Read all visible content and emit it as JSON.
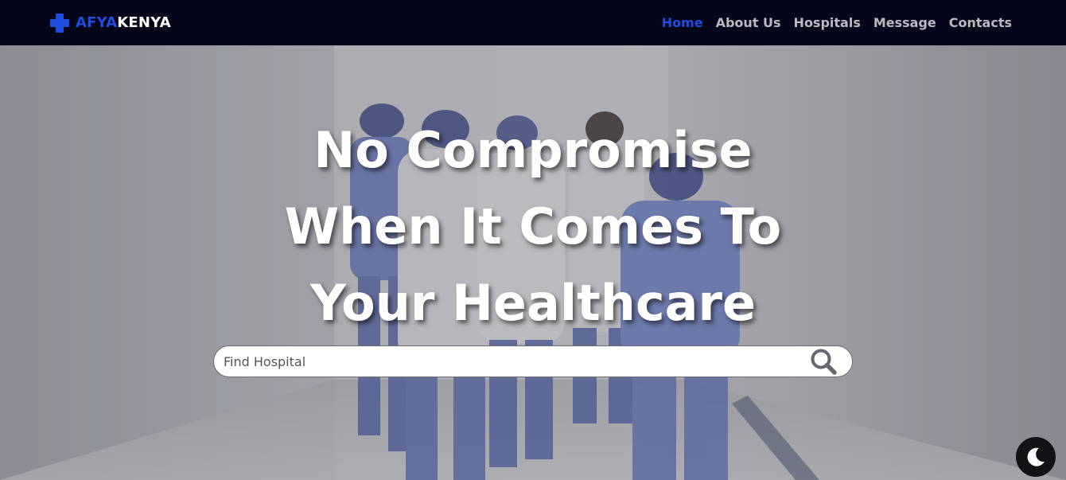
{
  "brand": {
    "part1": "AFYA",
    "part2": "KENYA",
    "accent_color": "#1e4de0",
    "icon": "medical-cross-icon"
  },
  "nav": {
    "items": [
      {
        "label": "Home",
        "active": true
      },
      {
        "label": "About Us",
        "active": false
      },
      {
        "label": "Hospitals",
        "active": false
      },
      {
        "label": "Message",
        "active": false
      },
      {
        "label": "Contacts",
        "active": false
      }
    ]
  },
  "hero": {
    "title": "No Compromise When It Comes To Your Healthcare",
    "search": {
      "placeholder": "Find Hospital",
      "value": "",
      "icon": "search-icon"
    }
  },
  "theme_toggle": {
    "icon": "moon-icon"
  }
}
